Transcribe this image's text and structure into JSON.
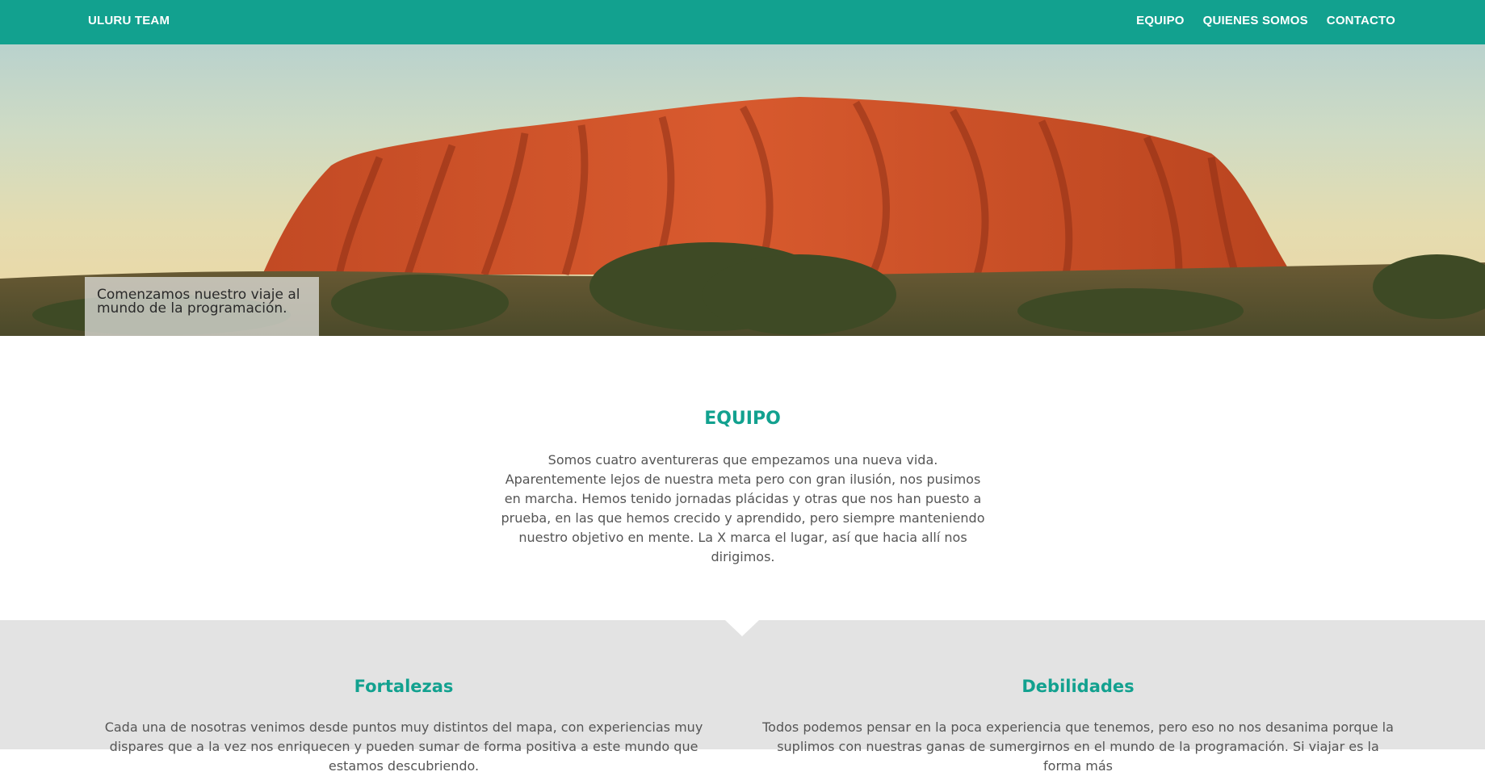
{
  "navbar": {
    "brand": "ULURU TEAM",
    "links": [
      {
        "label": "EQUIPO"
      },
      {
        "label": "QUIENES SOMOS"
      },
      {
        "label": "CONTACTO"
      }
    ]
  },
  "hero": {
    "caption": "Comenzamos nuestro viaje al mundo de la programación."
  },
  "team": {
    "title": "EQUIPO",
    "text": "Somos cuatro aventureras que empezamos una nueva vida. Aparentemente lejos de nuestra meta pero con gran ilusión, nos pusimos en marcha. Hemos tenido jornadas plácidas y otras que nos han puesto a prueba, en las que hemos crecido y aprendido, pero siempre manteniendo nuestro objetivo en mente. La X marca el lugar, así que hacia allí nos dirigimos."
  },
  "strengths": {
    "title": "Fortalezas",
    "text": "Cada una de nosotras venimos desde puntos muy distintos del mapa, con experiencias muy dispares que a la vez nos enriquecen y pueden sumar de forma positiva a este mundo que estamos descubriendo."
  },
  "weaknesses": {
    "title": "Debilidades",
    "text": "Todos podemos pensar en la poca experiencia que tenemos, pero eso no nos desanima porque la suplimos con nuestras ganas de sumergirnos en el mundo de la programación. Si viajar es la forma más"
  },
  "colors": {
    "accent": "#12a18f",
    "rock": "#c9522a",
    "gray_section": "#e3e3e3"
  }
}
